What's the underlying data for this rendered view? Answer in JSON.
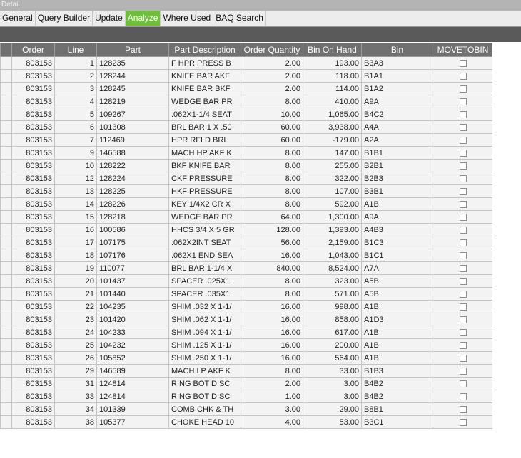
{
  "window": {
    "title": "Detail"
  },
  "tabs": [
    {
      "label": "General",
      "active": false
    },
    {
      "label": "Query Builder",
      "active": false
    },
    {
      "label": "Update",
      "active": false
    },
    {
      "label": "Analyze",
      "active": true
    },
    {
      "label": "Where Used",
      "active": false
    },
    {
      "label": "BAQ Search",
      "active": false
    }
  ],
  "grid": {
    "columns": [
      "Order",
      "Line",
      "Part",
      "Part Description",
      "Order Quantity",
      "Bin On Hand",
      "Bin",
      "MOVETOBIN"
    ],
    "rows": [
      [
        "803153",
        "1",
        "128235",
        "F HPR PRESS B",
        "2.00",
        "193.00",
        "B3A3"
      ],
      [
        "803153",
        "2",
        "128244",
        "KNIFE BAR AKF",
        "2.00",
        "118.00",
        "B1A1"
      ],
      [
        "803153",
        "3",
        "128245",
        "KNIFE BAR BKF",
        "2.00",
        "114.00",
        "B1A2"
      ],
      [
        "803153",
        "4",
        "128219",
        "WEDGE BAR PR",
        "8.00",
        "410.00",
        "A9A"
      ],
      [
        "803153",
        "5",
        "109267",
        ".062X1-1/4 SEAT",
        "10.00",
        "1,065.00",
        "B4C2"
      ],
      [
        "803153",
        "6",
        "101308",
        "BRL BAR 1 X .50",
        "60.00",
        "3,938.00",
        "A4A"
      ],
      [
        "803153",
        "7",
        "112469",
        "HPR RFLD BRL",
        "60.00",
        "-179.00",
        "A2A"
      ],
      [
        "803153",
        "9",
        "146588",
        "MACH HP AKF K",
        "8.00",
        "147.00",
        "B1B1"
      ],
      [
        "803153",
        "10",
        "128222",
        "BKF KNIFE BAR",
        "8.00",
        "255.00",
        "B2B1"
      ],
      [
        "803153",
        "12",
        "128224",
        "CKF PRESSURE",
        "8.00",
        "322.00",
        "B2B3"
      ],
      [
        "803153",
        "13",
        "128225",
        "HKF PRESSURE",
        "8.00",
        "107.00",
        "B3B1"
      ],
      [
        "803153",
        "14",
        "128226",
        "KEY 1/4X2 CR X",
        "8.00",
        "592.00",
        "A1B"
      ],
      [
        "803153",
        "15",
        "128218",
        "WEDGE BAR PR",
        "64.00",
        "1,300.00",
        "A9A"
      ],
      [
        "803153",
        "16",
        "100586",
        "HHCS 3/4 X 5 GR",
        "128.00",
        "1,393.00",
        "A4B3"
      ],
      [
        "803153",
        "17",
        "107175",
        ".062X2INT SEAT",
        "56.00",
        "2,159.00",
        "B1C3"
      ],
      [
        "803153",
        "18",
        "107176",
        ".062X1 END SEA",
        "16.00",
        "1,043.00",
        "B1C1"
      ],
      [
        "803153",
        "19",
        "110077",
        "BRL BAR 1-1/4 X",
        "840.00",
        "8,524.00",
        "A7A"
      ],
      [
        "803153",
        "20",
        "101437",
        "SPACER .025X1",
        "8.00",
        "323.00",
        "A5B"
      ],
      [
        "803153",
        "21",
        "101440",
        "SPACER .035X1",
        "8.00",
        "571.00",
        "A5B"
      ],
      [
        "803153",
        "22",
        "104235",
        "SHIM .032 X 1-1/",
        "16.00",
        "998.00",
        "A1B"
      ],
      [
        "803153",
        "23",
        "101420",
        "SHIM .062 X 1-1/",
        "16.00",
        "858.00",
        "A1D3"
      ],
      [
        "803153",
        "24",
        "104233",
        "SHIM .094 X 1-1/",
        "16.00",
        "617.00",
        "A1B"
      ],
      [
        "803153",
        "25",
        "104232",
        "SHIM .125 X 1-1/",
        "16.00",
        "200.00",
        "A1B"
      ],
      [
        "803153",
        "26",
        "105852",
        "SHIM .250 X 1-1/",
        "16.00",
        "564.00",
        "A1B"
      ],
      [
        "803153",
        "29",
        "146589",
        "MACH LP AKF K",
        "8.00",
        "33.00",
        "B1B3"
      ],
      [
        "803153",
        "31",
        "124814",
        "RING BOT DISC",
        "2.00",
        "3.00",
        "B4B2"
      ],
      [
        "803153",
        "33",
        "124814",
        "RING BOT DISC",
        "1.00",
        "3.00",
        "B4B2"
      ],
      [
        "803153",
        "34",
        "101339",
        "COMB CHK & TH",
        "3.00",
        "29.00",
        "B8B1"
      ],
      [
        "803153",
        "38",
        "105377",
        "CHOKE HEAD 10",
        "4.00",
        "53.00",
        "B3C1"
      ]
    ]
  },
  "colors": {
    "active_tab": "#6fbf3c",
    "header_bg": "#707070",
    "toolbar_bg": "#5a5a5a"
  }
}
